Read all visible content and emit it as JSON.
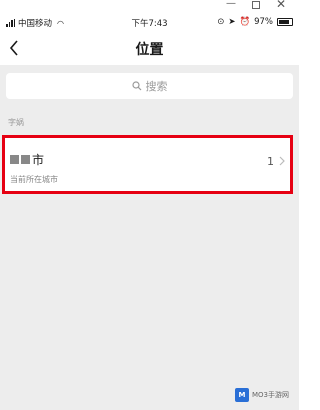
{
  "window": {
    "minimize_icon": "minimize-icon",
    "maximize_icon": "maximize-icon",
    "close_icon": "close-icon"
  },
  "status_bar": {
    "carrier": "中国移动",
    "time": "下午7:43",
    "battery": "97%"
  },
  "nav": {
    "title": "位置",
    "back_icon": "chevron-left-icon"
  },
  "search": {
    "placeholder": "搜索"
  },
  "section": {
    "label": "字娲"
  },
  "location": {
    "name_suffix": "市",
    "subtitle": "当前所在城市",
    "count": "1"
  },
  "watermark": {
    "logo_text": "M",
    "text": "MO3手游网"
  },
  "colors": {
    "highlight_border": "#e60012",
    "background": "#ededed"
  }
}
